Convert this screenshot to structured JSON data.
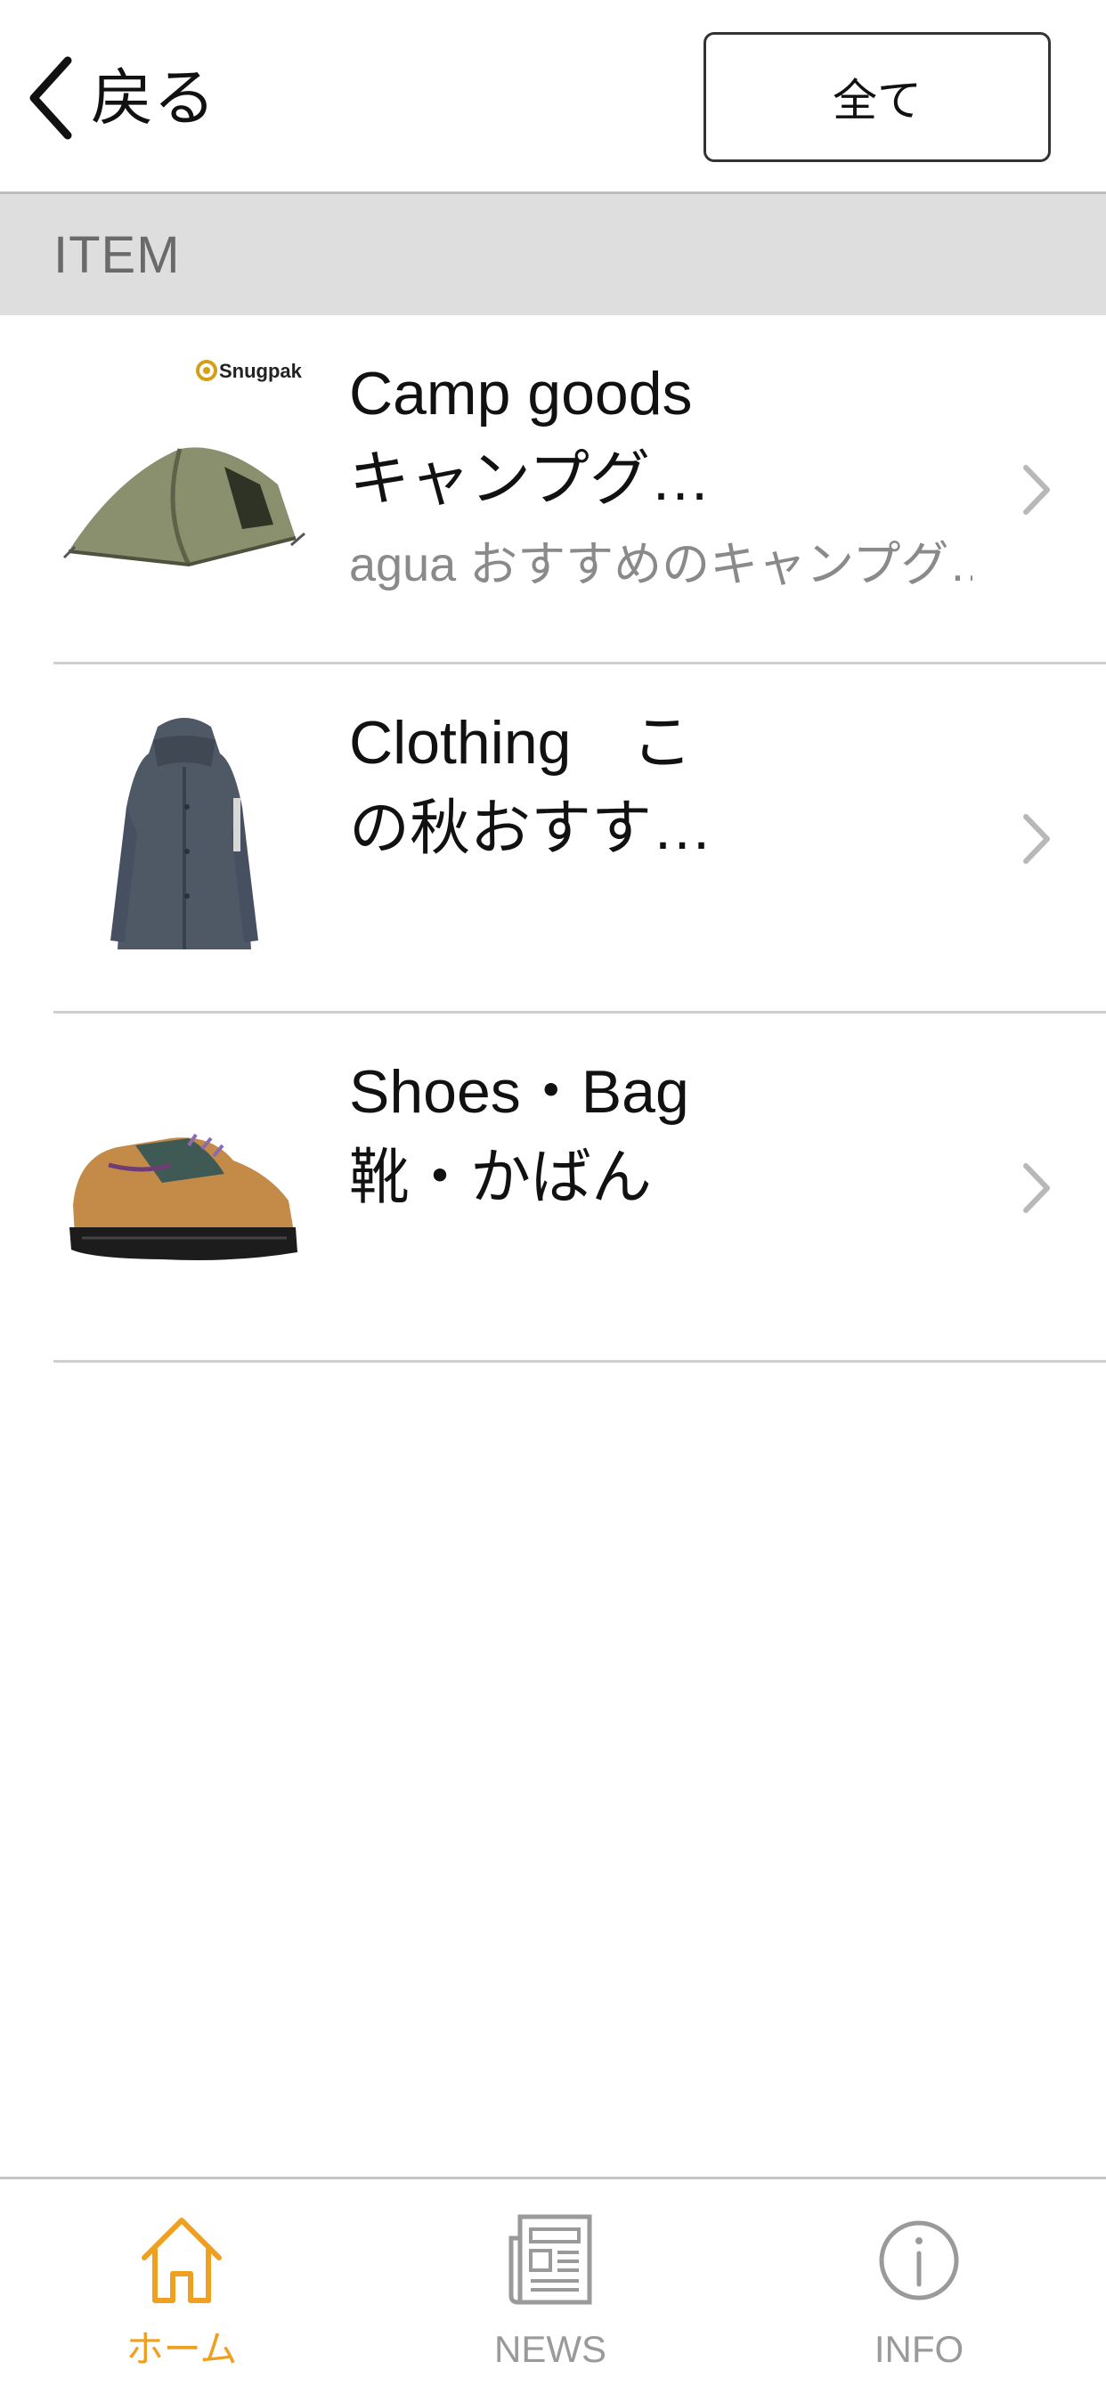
{
  "header": {
    "back_label": "戻る",
    "all_button_label": "全て"
  },
  "section": {
    "title": "ITEM"
  },
  "items": [
    {
      "title": "Camp goods",
      "subtitle": "キャンプグ…",
      "description": "agua おすすめのキャンプグ…",
      "thumb_icon": "tent-image",
      "brand_text": "Snugpak"
    },
    {
      "title": "Clothing　こ",
      "subtitle": "の秋おすす…",
      "description": "",
      "thumb_icon": "coat-image"
    },
    {
      "title": "Shoes・Bag",
      "subtitle": "靴・かばん",
      "description": "",
      "thumb_icon": "shoe-image"
    }
  ],
  "tabbar": {
    "tabs": [
      {
        "label": "ホーム",
        "icon": "home-icon",
        "active": true
      },
      {
        "label": "NEWS",
        "icon": "newspaper-icon",
        "active": false
      },
      {
        "label": "INFO",
        "icon": "info-icon",
        "active": false
      }
    ]
  },
  "colors": {
    "accent": "#f0a020",
    "inactive": "#9a9a9a",
    "section_bg": "#dedede"
  }
}
